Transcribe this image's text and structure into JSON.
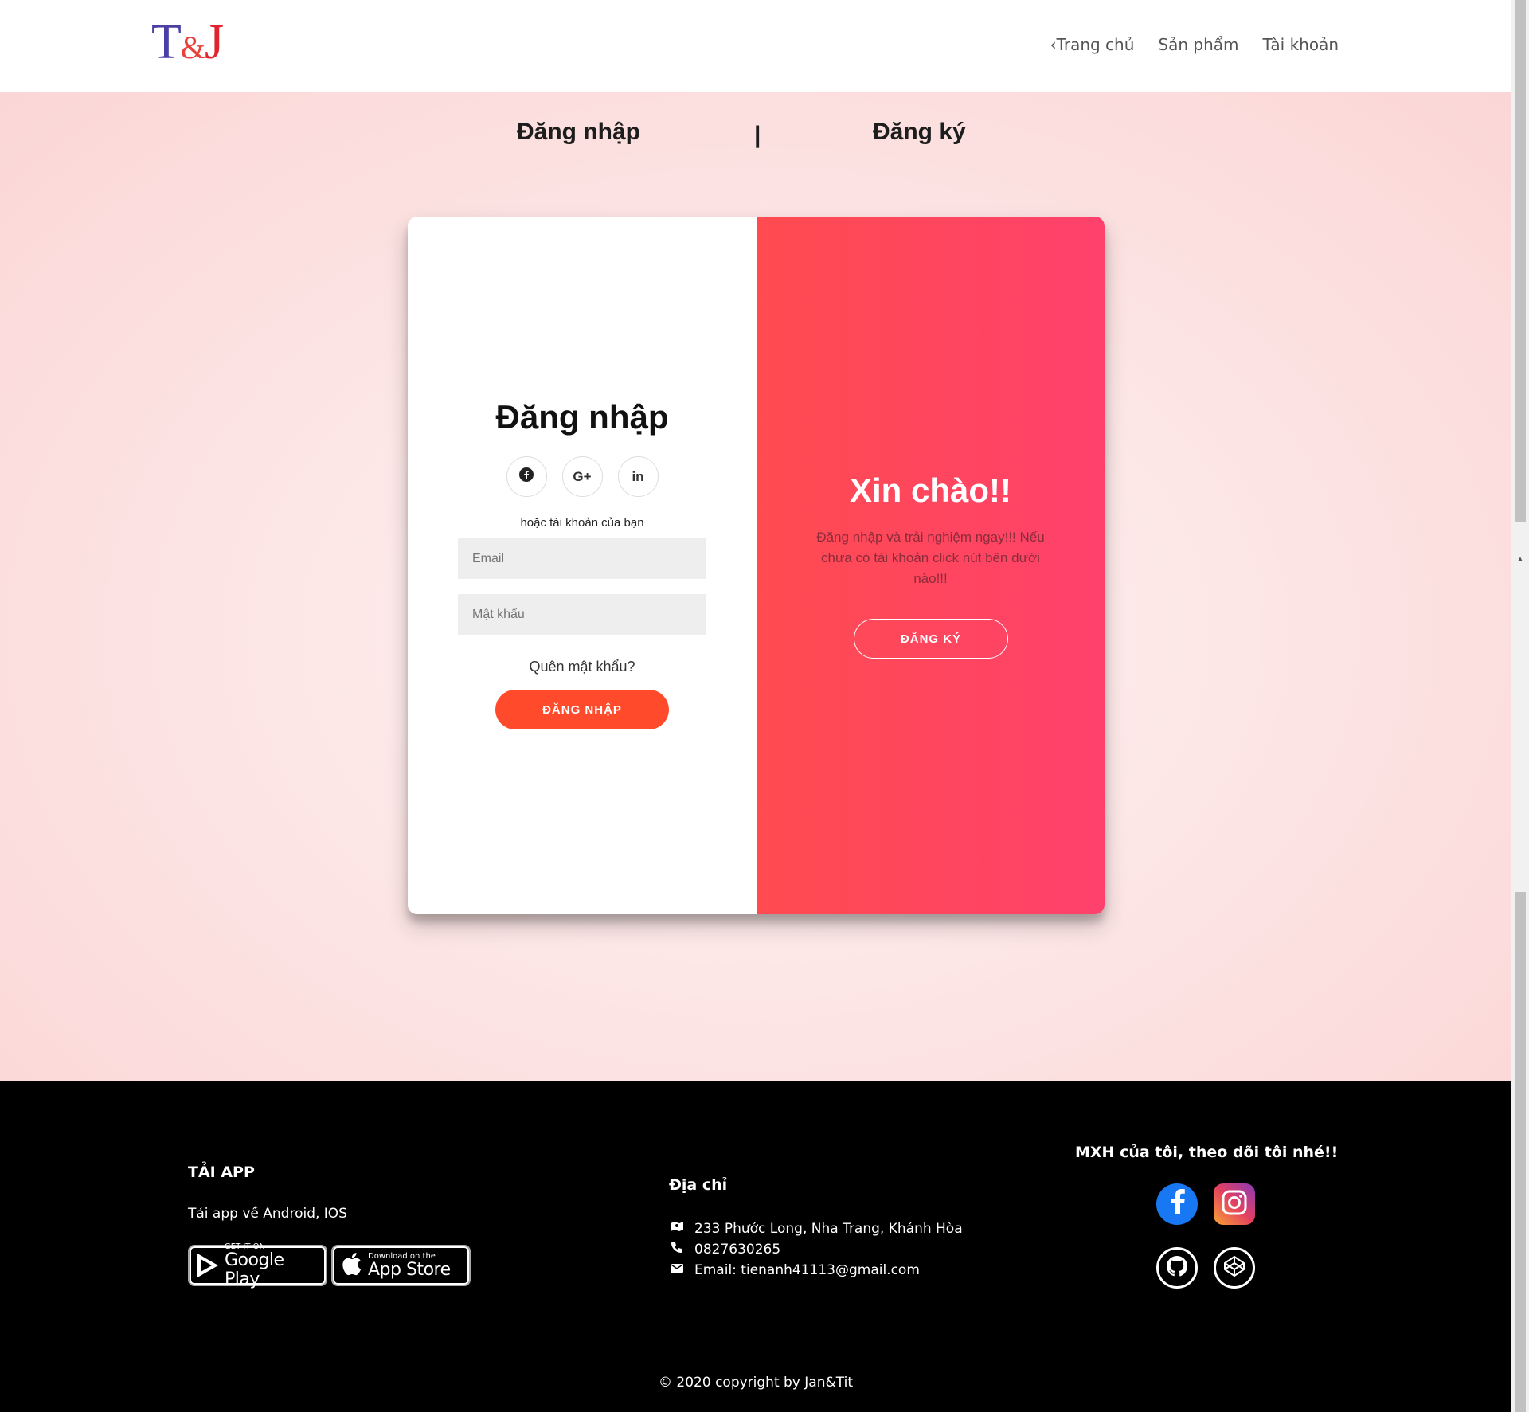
{
  "header": {
    "logo": {
      "t": "T",
      "amp": "&",
      "j": "J"
    },
    "nav": [
      {
        "label": "‹Trang chủ"
      },
      {
        "label": "Sản phẩm"
      },
      {
        "label": "Tài khoản"
      }
    ]
  },
  "switcher": {
    "login": "Đăng nhập",
    "separator": "|",
    "register": "Đăng ký"
  },
  "login": {
    "title": "Đăng nhập",
    "socials": [
      {
        "icon": "facebook-icon",
        "glyph": "f"
      },
      {
        "icon": "google-plus-icon",
        "glyph": "G+"
      },
      {
        "icon": "linkedin-icon",
        "glyph": "in"
      }
    ],
    "or_text": "hoặc tài khoản của bạn",
    "email_placeholder": "Email",
    "password_placeholder": "Mật khẩu",
    "forgot": "Quên mật khẩu?",
    "button": "ĐĂNG NHẬP"
  },
  "welcome": {
    "title": "Xin chào!!",
    "text": "Đăng nhập và trải nghiệm ngay!!! Nếu chưa có tài khoản click nút bên dưới nào!!!",
    "button": "ĐĂNG KÝ"
  },
  "footer": {
    "app_title": "TẢI APP",
    "app_text": "Tải app về Android, IOS",
    "google_play": {
      "small": "GET IT ON",
      "big": "Google Play"
    },
    "app_store": {
      "small": "Download on the",
      "big": "App Store"
    },
    "address_title": "Địa chỉ",
    "address": "233 Phước Long, Nha Trang, Khánh Hòa",
    "phone": "0827630265",
    "email": "Email: tienanh41113@gmail.com",
    "social_title": "MXH của tôi, theo dõi tôi nhé!!",
    "copyright": "© 2020 copyright by Jan&Tit"
  },
  "colors": {
    "accent": "#ff4b2b",
    "panel_gradient_start": "#ff4b50",
    "panel_gradient_end": "#ff416c",
    "background_pink": "#fbd6d6"
  }
}
